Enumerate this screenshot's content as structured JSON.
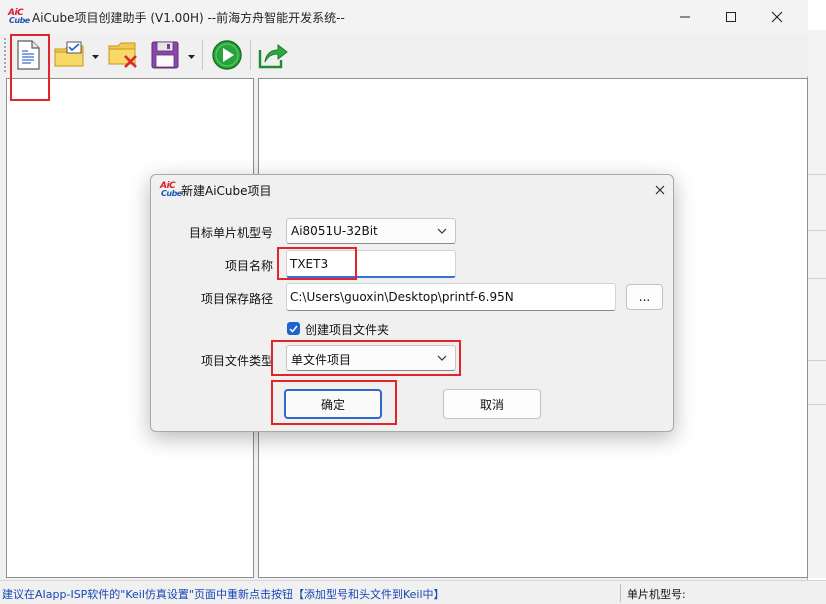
{
  "window": {
    "title": "AiCube项目创建助手 (V1.00H) --前海方舟智能开发系统--",
    "logo_text_top": "AiC",
    "logo_text_bottom": "Cube"
  },
  "toolbar": {
    "buttons": [
      {
        "name": "new-project",
        "icon": "document-icon"
      },
      {
        "name": "open-project",
        "icon": "folder-check-icon",
        "has_dropdown": true
      },
      {
        "name": "close-project",
        "icon": "folder-delete-icon"
      },
      {
        "name": "save-project",
        "icon": "floppy-disk-icon",
        "has_dropdown": true
      },
      {
        "name": "run",
        "icon": "play-icon"
      },
      {
        "name": "export",
        "icon": "share-arrow-icon"
      }
    ]
  },
  "dialog": {
    "title": "新建AiCube项目",
    "logo_text_top": "AiC",
    "logo_text_bottom": "Cube",
    "mcu_label": "目标单片机型号",
    "mcu_value": "Ai8051U-32Bit",
    "name_label": "项目名称",
    "name_value": "TXET3",
    "path_label": "项目保存路径",
    "path_value": "C:\\Users\\guoxin\\Desktop\\printf-6.95N",
    "browse_label": "...",
    "create_folder_label": "创建项目文件夹",
    "create_folder_checked": true,
    "type_label": "项目文件类型",
    "type_value": "单文件项目",
    "ok_label": "确定",
    "cancel_label": "取消"
  },
  "status": {
    "hint": "建议在AIapp-ISP软件的\"Keil仿真设置\"页面中重新点击按钮【添加型号和头文件到Keil中】",
    "mcu_label": "单片机型号:"
  },
  "colors": {
    "highlight": "#e0252b",
    "accent": "#1f63cc",
    "status_text": "#1446b8"
  }
}
